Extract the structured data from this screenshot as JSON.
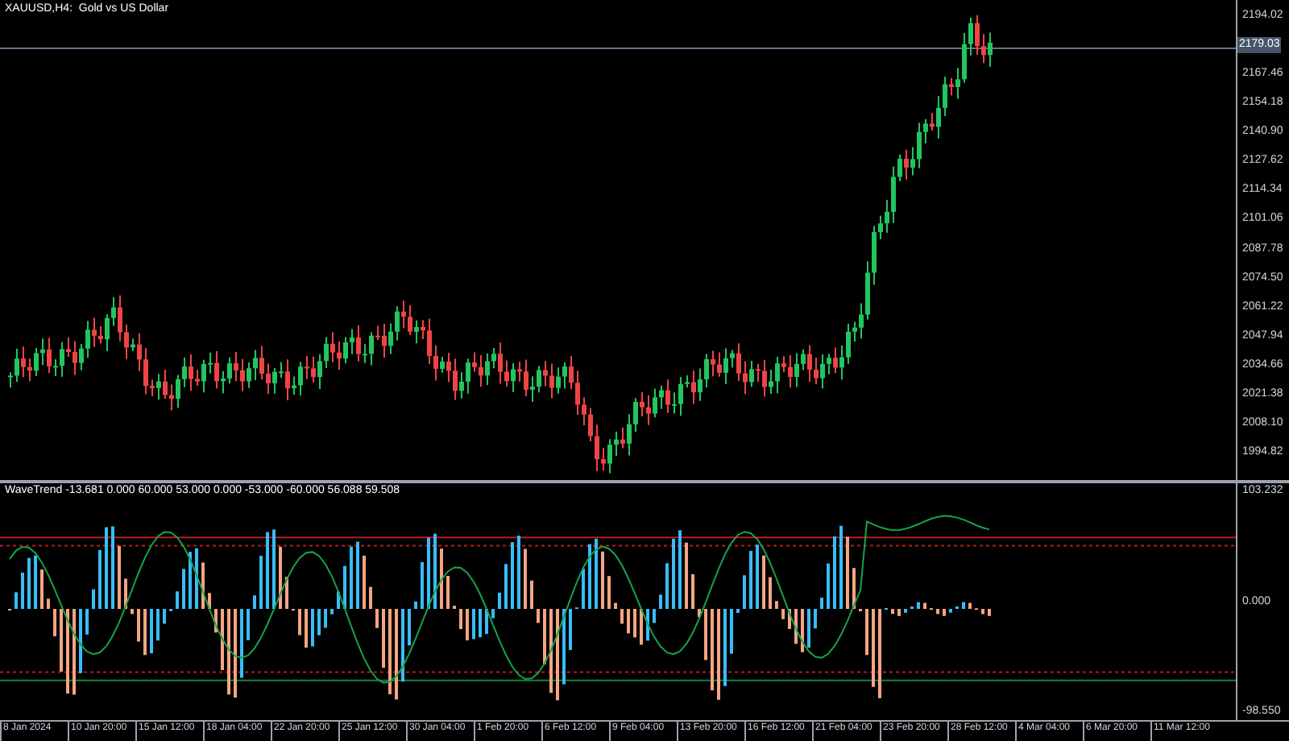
{
  "chart": {
    "title": "XAUUSD,H4:  Gold vs US Dollar",
    "price_axis": {
      "labels": [
        "2194.02",
        "2167.46",
        "2154.18",
        "2140.90",
        "2127.62",
        "2114.34",
        "2101.06",
        "2087.78",
        "2074.50",
        "2061.22",
        "2047.94",
        "2034.66",
        "2021.38",
        "2008.10",
        "1994.82"
      ],
      "current_price": "2179.03"
    }
  },
  "indicator": {
    "label": "WaveTrend -13.681 0.000 60.000 53.000 0.000 -53.000 -60.000 56.088 59.508",
    "axis_labels": [
      "103.232",
      "0.000",
      "-98.550"
    ]
  },
  "time_axis": {
    "labels": [
      "8 Jan 2024",
      "10 Jan 20:00",
      "15 Jan 12:00",
      "18 Jan 04:00",
      "22 Jan 20:00",
      "25 Jan 12:00",
      "30 Jan 04:00",
      "1 Feb 20:00",
      "6 Feb 12:00",
      "9 Feb 04:00",
      "13 Feb 20:00",
      "16 Feb 12:00",
      "21 Feb 04:00",
      "23 Feb 20:00",
      "28 Feb 12:00",
      "4 Mar 04:00",
      "6 Mar 20:00",
      "11 Mar 12:00"
    ]
  }
}
